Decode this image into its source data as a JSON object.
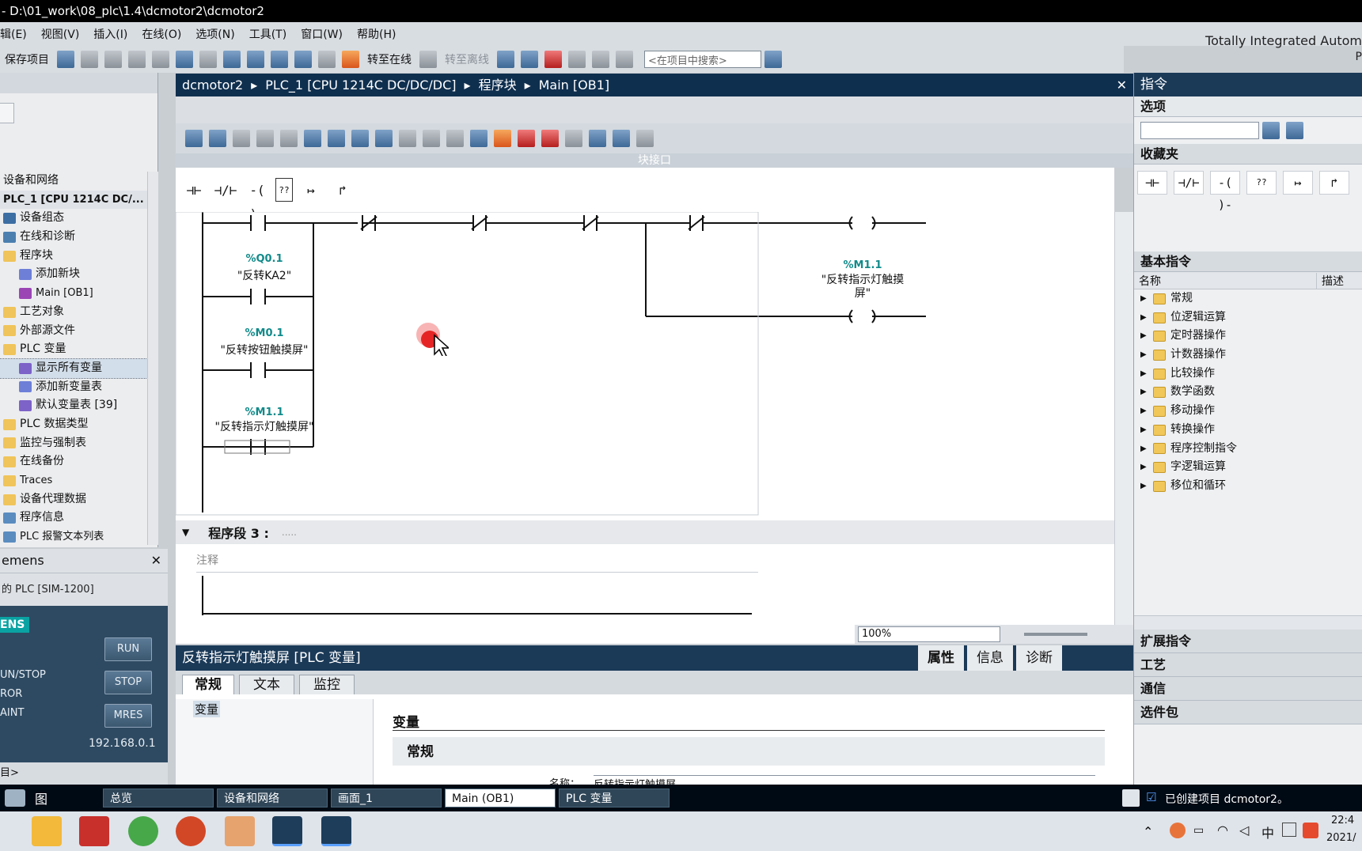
{
  "window": {
    "title": "- D:\\01_work\\08_plc\\1.4\\dcmotor2\\dcmotor2"
  },
  "menu": [
    "辑(E)",
    "视图(V)",
    "插入(I)",
    "在线(O)",
    "选项(N)",
    "工具(T)",
    "窗口(W)",
    "帮助(H)"
  ],
  "brand": {
    "line1": "Totally Integrated Autom",
    "line2": "P"
  },
  "toolbar": {
    "save_label": "保存项目",
    "go_online": "转至在线",
    "go_offline": "转至离线",
    "search_placeholder": "<在项目中搜索>"
  },
  "tree": {
    "items": [
      {
        "label": "设备和网络",
        "icon": "network-icon"
      },
      {
        "label": "PLC_1 [CPU 1214C DC/...",
        "icon": "cpu-icon"
      },
      {
        "label": "设备组态",
        "icon": "device-config-icon"
      },
      {
        "label": "在线和诊断",
        "icon": "online-diagnostics-icon"
      },
      {
        "label": "程序块",
        "icon": "folder-icon"
      },
      {
        "label": "添加新块",
        "icon": "add-block-icon"
      },
      {
        "label": "Main [OB1]",
        "icon": "ob-block-icon"
      },
      {
        "label": "工艺对象",
        "icon": "folder-icon"
      },
      {
        "label": "外部源文件",
        "icon": "folder-icon"
      },
      {
        "label": "PLC 变量",
        "icon": "folder-icon"
      },
      {
        "label": "显示所有变量",
        "icon": "tag-table-icon"
      },
      {
        "label": "添加新变量表",
        "icon": "add-tag-table-icon"
      },
      {
        "label": "默认变量表 [39]",
        "icon": "tag-table-icon"
      },
      {
        "label": "PLC 数据类型",
        "icon": "folder-icon"
      },
      {
        "label": "监控与强制表",
        "icon": "folder-icon"
      },
      {
        "label": "在线备份",
        "icon": "folder-icon"
      },
      {
        "label": "Traces",
        "icon": "folder-icon"
      },
      {
        "label": "设备代理数据",
        "icon": "folder-icon"
      },
      {
        "label": "程序信息",
        "icon": "info-icon"
      },
      {
        "label": "PLC 报警文本列表",
        "icon": "alarm-list-icon"
      }
    ]
  },
  "sim": {
    "title": "emens",
    "plc": "的 PLC [SIM-1200]",
    "logo": "ENS",
    "run": "RUN",
    "stop": "STOP",
    "mres": "MRES",
    "labels": [
      "UN/STOP",
      "ROR",
      "AINT"
    ],
    "ip": "192.168.0.1",
    "footer": "目>"
  },
  "editor": {
    "breadcrumb": [
      "dcmotor2",
      "PLC_1 [CPU 1214C DC/DC/DC]",
      "程序块",
      "Main [OB1]"
    ],
    "block_interface": "块接口",
    "ladder_symbols": [
      "⊣⊢",
      "⊣/⊢",
      "-( )-",
      "??",
      "↦",
      "↱"
    ],
    "contacts": [
      {
        "addr": "%Q0.1",
        "name": "\"反转KA2\""
      },
      {
        "addr": "%M0.1",
        "name": "\"反转按钮触摸屏\""
      },
      {
        "addr": "%M1.1",
        "name": "\"反转指示灯触摸屏\""
      }
    ],
    "coil": {
      "addr": "%M1.1",
      "name": "\"反转指示灯触摸屏\""
    },
    "segment3": {
      "title": "程序段 3 :",
      "dots": ".....",
      "comment": "注释"
    },
    "zoom": "100%"
  },
  "inspector": {
    "title": "反转指示灯触摸屏 [PLC 变量]",
    "tabs": [
      "常规",
      "文本",
      "监控"
    ],
    "right_tabs": [
      "属性",
      "信息",
      "诊断"
    ],
    "nav_item": "变量",
    "section": "变量",
    "subsection": "常规",
    "field_label": "名称：",
    "field_value": "反转指示灯触摸屏"
  },
  "taskcard": {
    "title": "指令",
    "options": "选项",
    "favorites": "收藏夹",
    "basic": "基本指令",
    "col_name": "名称",
    "col_desc": "描述",
    "basic_items": [
      "常规",
      "位逻辑运算",
      "定时器操作",
      "计数器操作",
      "比较操作",
      "数学函数",
      "移动操作",
      "转换操作",
      "程序控制指令",
      "字逻辑运算",
      "移位和循环"
    ],
    "collapsed": [
      "扩展指令",
      "工艺",
      "通信",
      "选件包"
    ]
  },
  "statusbar": {
    "overview": "总览",
    "tabs": [
      "设备和网络",
      "画面_1",
      "Main (OB1)",
      "PLC 变量"
    ],
    "view_label": "图",
    "message": "已创建项目 dcmotor2。"
  },
  "clock": {
    "time": "22:4",
    "date": "2021/"
  }
}
